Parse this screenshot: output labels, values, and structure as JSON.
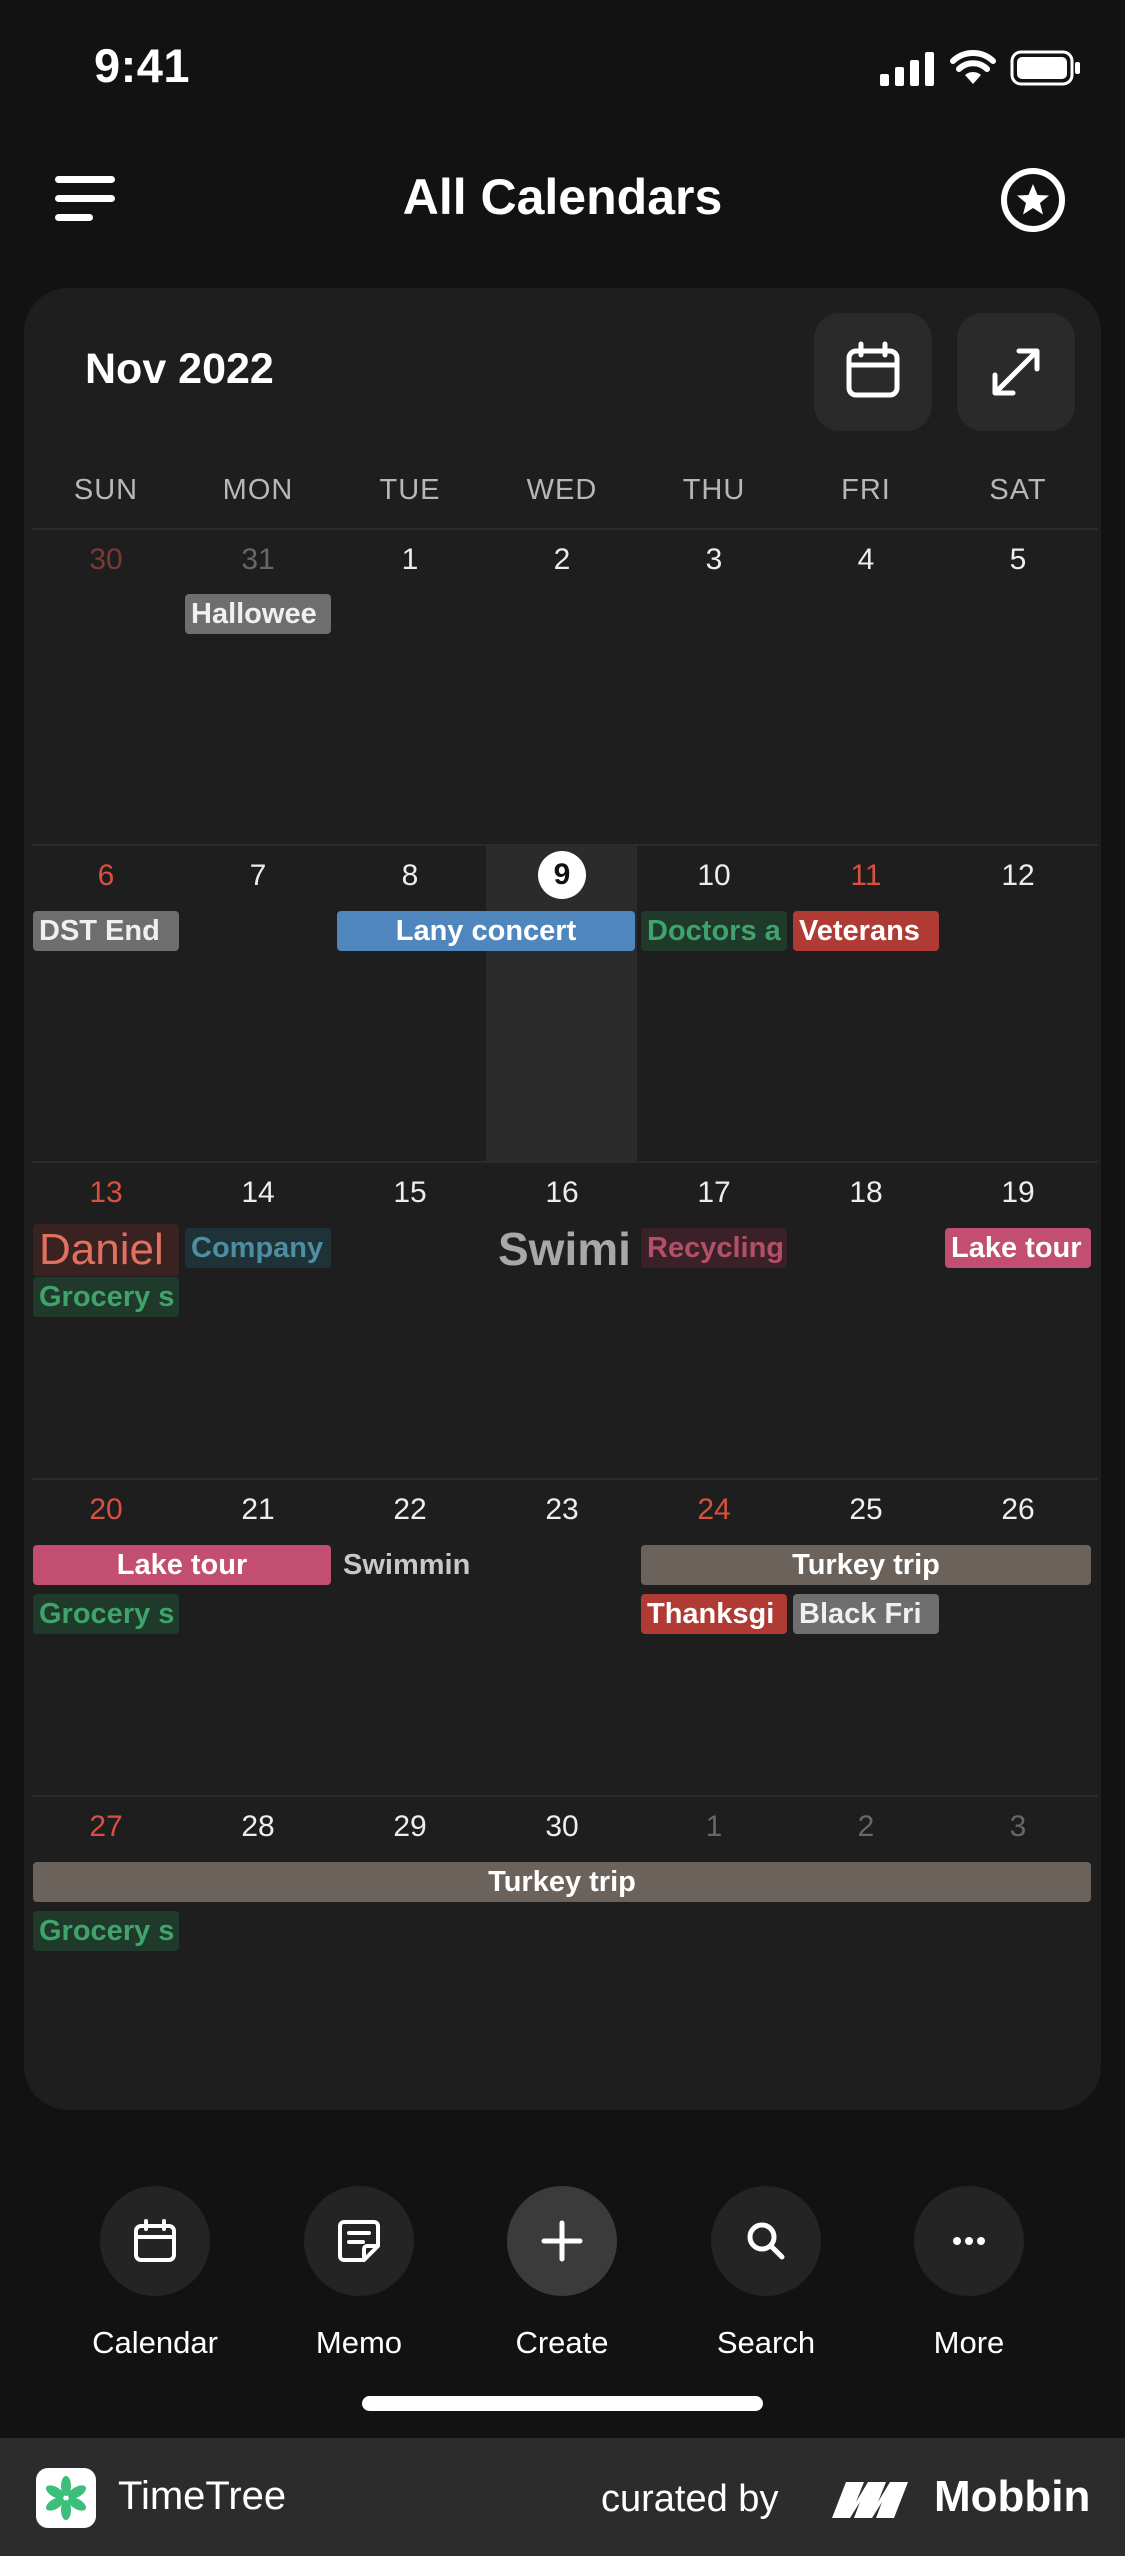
{
  "status": {
    "time": "9:41"
  },
  "header": {
    "title": "All Calendars"
  },
  "calendar": {
    "month_label": "Nov 2022",
    "weekdays": [
      "SUN",
      "MON",
      "TUE",
      "WED",
      "THU",
      "FRI",
      "SAT"
    ],
    "weeks": [
      [
        "30",
        "31",
        "1",
        "2",
        "3",
        "4",
        "5"
      ],
      [
        "6",
        "7",
        "8",
        "9",
        "10",
        "11",
        "12"
      ],
      [
        "13",
        "14",
        "15",
        "16",
        "17",
        "18",
        "19"
      ],
      [
        "20",
        "21",
        "22",
        "23",
        "24",
        "25",
        "26"
      ],
      [
        "27",
        "28",
        "29",
        "30",
        "1",
        "2",
        "3"
      ]
    ],
    "events": {
      "halloween": "Hallowee",
      "dst_end": "DST End",
      "lany_concert": "Lany concert",
      "doctors": "Doctors a",
      "veterans": "Veterans",
      "daniel": "Daniel",
      "company": "Company",
      "swimming_big": "Swimi",
      "recycling": "Recycling",
      "lake_tour_19": "Lake tour",
      "grocery_13": "Grocery s",
      "lake_tour_20": "Lake tour",
      "swimming_22": "Swimmin",
      "turkey_trip_w4": "Turkey trip",
      "grocery_20": "Grocery s",
      "thanksgiving": "Thanksgi",
      "black_friday": "Black Fri",
      "turkey_trip_w5": "Turkey trip",
      "grocery_27": "Grocery s"
    }
  },
  "tabs": [
    {
      "label": "Calendar",
      "icon": "calendar-icon"
    },
    {
      "label": "Memo",
      "icon": "memo-icon"
    },
    {
      "label": "Create",
      "icon": "plus-icon"
    },
    {
      "label": "Search",
      "icon": "search-icon"
    },
    {
      "label": "More",
      "icon": "more-icon"
    }
  ],
  "footer": {
    "app_name": "TimeTree",
    "curated_by": "curated by",
    "brand": "Mobbin"
  },
  "colors": {
    "background": "#121212",
    "card": "#1e1e1e",
    "sunday_red": "#d95040",
    "event_gray": "#6e6e6e",
    "event_blue": "#4f86bd",
    "event_red": "#b03a34",
    "event_pink": "#c24e72",
    "event_brown": "#6b625c",
    "event_green_text": "#3fa36b",
    "event_teal_text": "#4d8fa1",
    "event_rose_text": "#b35068",
    "event_salmon_text": "#e07060"
  }
}
